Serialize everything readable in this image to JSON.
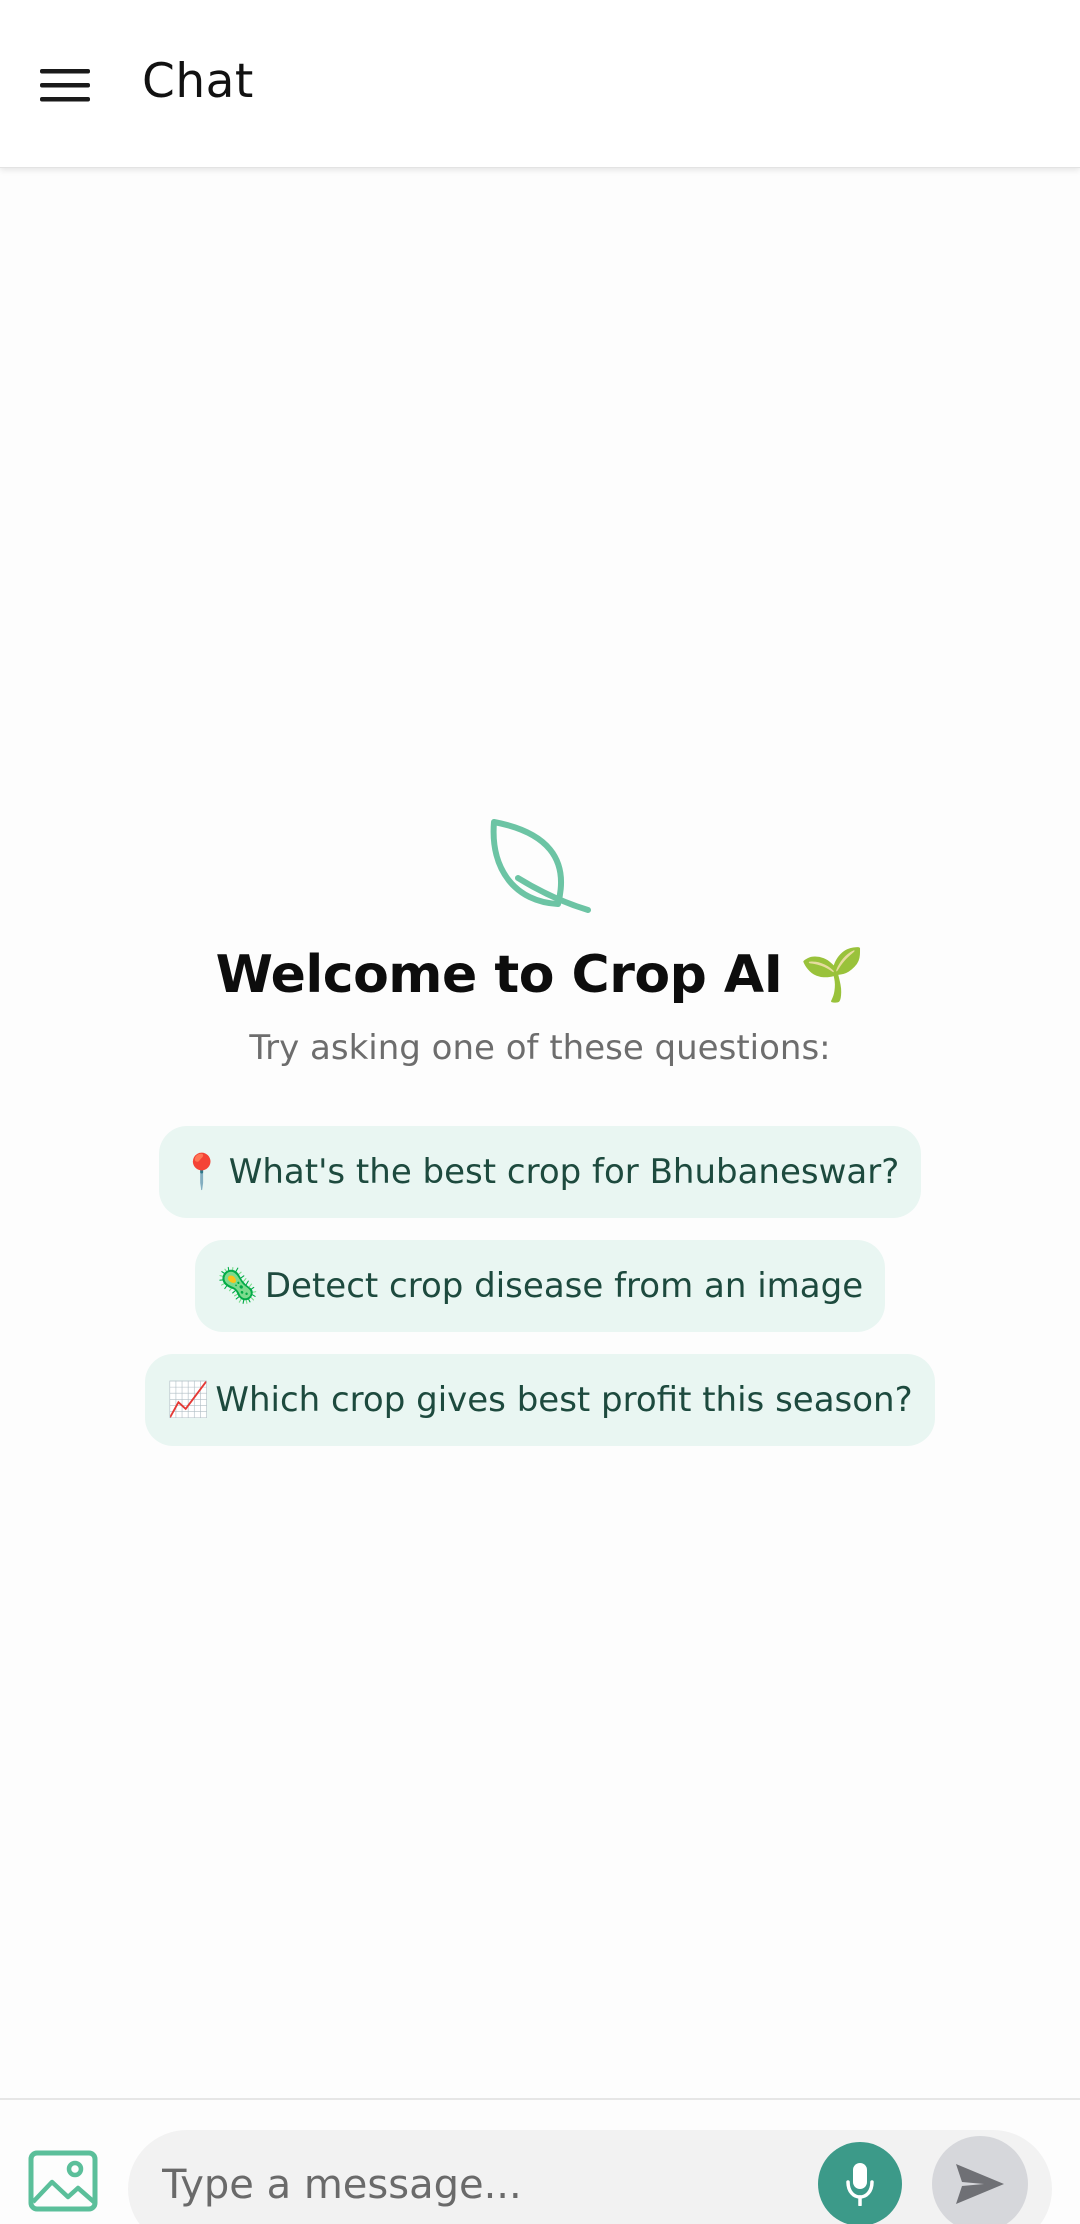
{
  "header": {
    "title": "Chat",
    "menu_icon": "hamburger-menu-icon"
  },
  "welcome": {
    "icon": "leaf-icon",
    "title": "Welcome to Crop AI 🌱",
    "subtitle": "Try asking one of these questions:"
  },
  "suggestions": [
    {
      "emoji": "📍",
      "text": "What's the best crop for Bhubaneswar?"
    },
    {
      "emoji": "🦠",
      "text": "Detect crop disease from an image"
    },
    {
      "emoji": "📈",
      "text": "Which crop gives best profit this season?"
    }
  ],
  "composer": {
    "placeholder": "Type a message...",
    "value": "",
    "image_icon": "image-icon",
    "mic_icon": "microphone-icon",
    "send_icon": "send-icon"
  },
  "colors": {
    "accent": "#3c9a89",
    "leaf": "#6cc4a4",
    "suggestion_bg": "#e9f6f2",
    "suggestion_text": "#1d4a3e",
    "send_disabled": "#d6d7db"
  }
}
